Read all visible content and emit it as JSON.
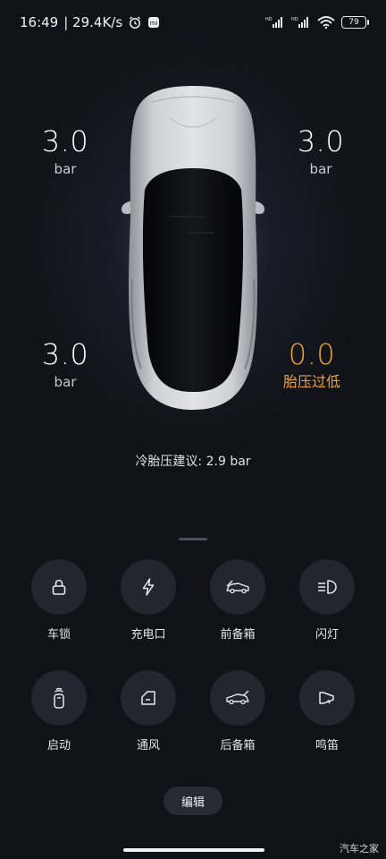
{
  "status_bar": {
    "time": "16:49",
    "network_speed": "| 29.4K/s",
    "battery_level": "79",
    "signal1_label": "HD",
    "signal2_label": "HD",
    "notif_badge": "mi"
  },
  "tires": {
    "front_left": {
      "value": "3.0",
      "unit": "bar"
    },
    "front_right": {
      "value": "3.0",
      "unit": "bar"
    },
    "rear_left": {
      "value": "3.0",
      "unit": "bar"
    },
    "rear_right": {
      "value": "0.0",
      "status": "胎压过低",
      "color": "#e9a23b"
    }
  },
  "advice": "冷胎压建议: 2.9 bar",
  "controls": [
    {
      "label": "车锁",
      "icon": "lock-icon"
    },
    {
      "label": "充电口",
      "icon": "charge-bolt-icon"
    },
    {
      "label": "前备箱",
      "icon": "front-trunk-icon"
    },
    {
      "label": "闪灯",
      "icon": "headlight-icon"
    },
    {
      "label": "启动",
      "icon": "car-key-icon"
    },
    {
      "label": "通风",
      "icon": "window-vent-icon"
    },
    {
      "label": "后备箱",
      "icon": "rear-trunk-icon"
    },
    {
      "label": "鸣笛",
      "icon": "horn-icon"
    }
  ],
  "edit_label": "编辑",
  "watermark": "汽车之家"
}
